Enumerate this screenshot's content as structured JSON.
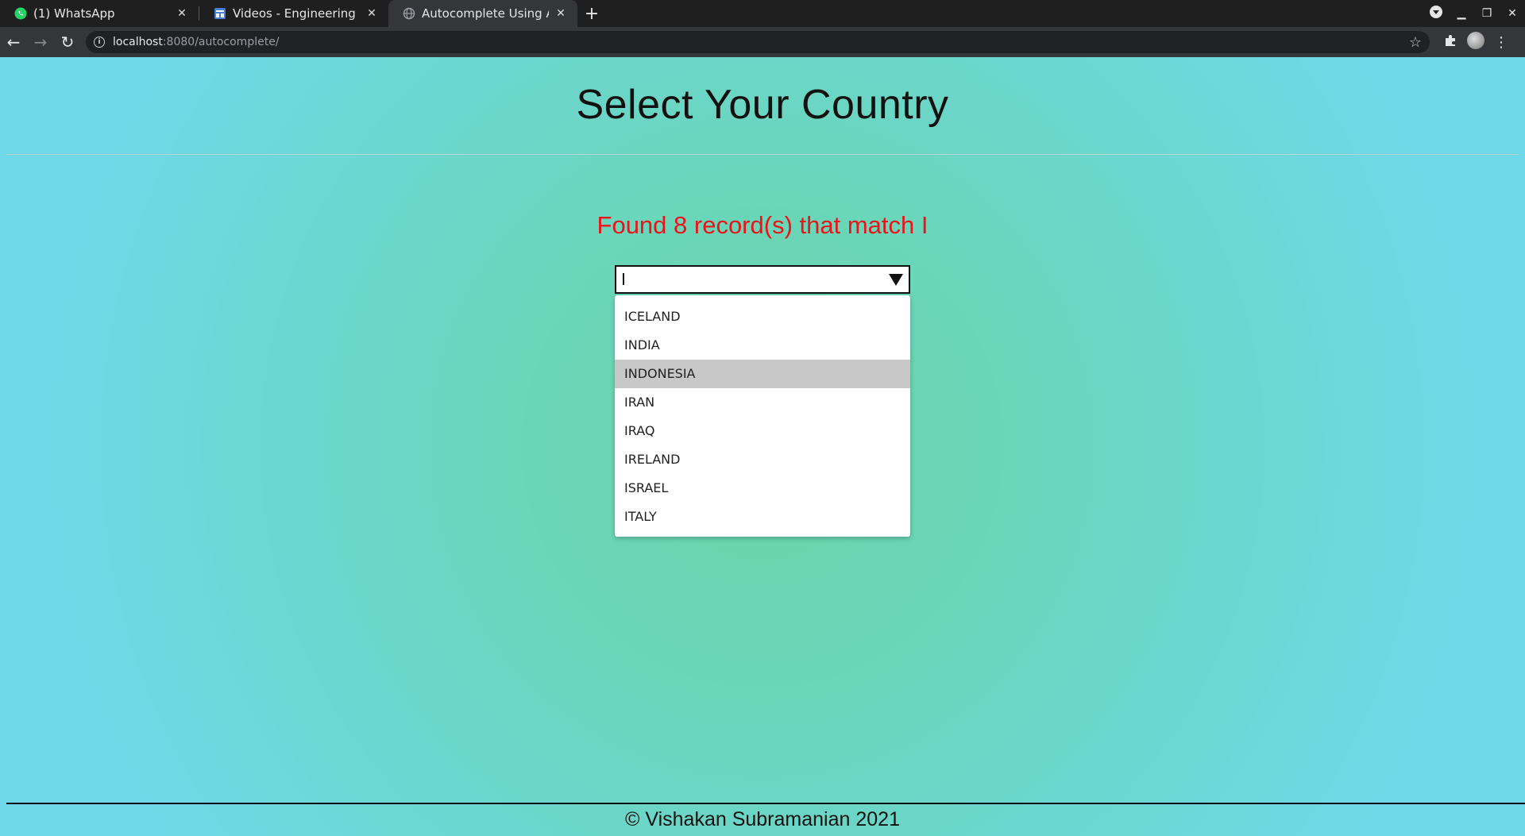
{
  "browser": {
    "tabs": [
      {
        "title": "(1) WhatsApp",
        "icon": "whatsapp-icon",
        "active": false
      },
      {
        "title": "Videos - Engineering Soft",
        "icon": "document-icon",
        "active": false
      },
      {
        "title": "Autocomplete Using AJA",
        "icon": "globe-icon",
        "active": true
      }
    ],
    "url_host": "localhost",
    "url_path": ":8080/autocomplete/"
  },
  "page": {
    "heading": "Select Your Country",
    "status_text": "Found 8 record(s) that match I",
    "status_color": "#e8151a",
    "search_value": "I",
    "highlighted_index": 2,
    "options": [
      "ICELAND",
      "INDIA",
      "INDONESIA",
      "IRAN",
      "IRAQ",
      "IRELAND",
      "ISRAEL",
      "ITALY"
    ],
    "footer": "© Vishakan Subramanian 2021"
  }
}
